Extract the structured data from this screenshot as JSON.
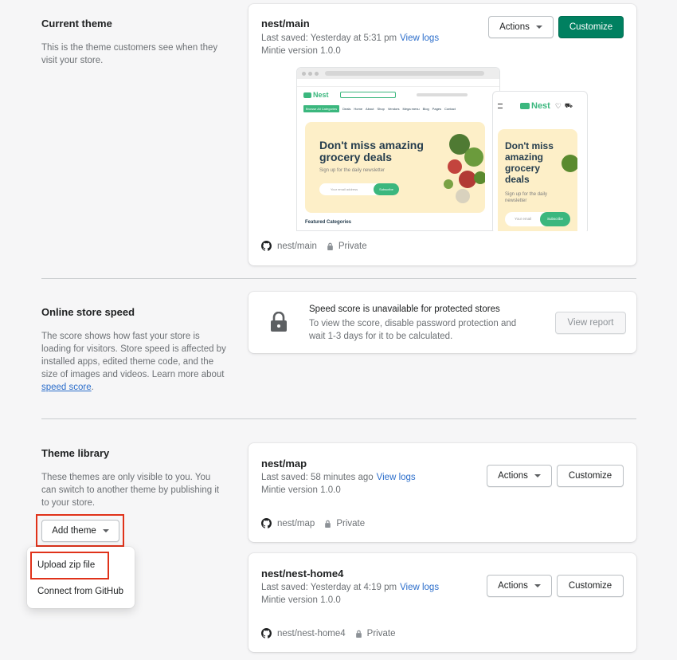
{
  "current_theme": {
    "title": "Current theme",
    "description": "This is the theme customers see when they visit your store.",
    "card": {
      "name": "nest/main",
      "last_saved": "Last saved: Yesterday at 5:31 pm",
      "view_logs": "View logs",
      "version": "Mintie version 1.0.0",
      "actions_label": "Actions",
      "customize_label": "Customize",
      "repo": "nest/main",
      "visibility": "Private"
    },
    "preview": {
      "desktop": {
        "logo": "Nest",
        "category_button": "Browse All Categories",
        "nav": [
          "Deals",
          "Home",
          "About",
          "Shop",
          "Vendors",
          "Mega menu",
          "Blog",
          "Pages",
          "Contact"
        ],
        "headline_line1": "Don't miss amazing",
        "headline_line2": "grocery deals",
        "subtext": "Sign up for the daily newsletter",
        "email_placeholder": "Your email address",
        "subscribe": "Subscribe",
        "featured": "Featured Categories"
      },
      "mobile": {
        "logo": "Nest",
        "headline_line1": "Don't miss",
        "headline_line2": "amazing",
        "headline_line3": "grocery",
        "headline_line4": "deals",
        "subtext": "Sign up for the daily newsletter",
        "email_placeholder": "Your email",
        "subscribe": "Subscribe"
      }
    }
  },
  "speed": {
    "title": "Online store speed",
    "description": "The score shows how fast your store is loading for visitors. Store speed is affected by installed apps, edited theme code, and the size of images and videos. Learn more about ",
    "link": "speed score",
    "period": ".",
    "card_title": "Speed score is unavailable for protected stores",
    "card_text": "To view the score, disable password protection and wait 1-3 days for it to be calculated.",
    "view_report": "View report"
  },
  "library": {
    "title": "Theme library",
    "description": "These themes are only visible to you. You can switch to another theme by publishing it to your store.",
    "add_theme": "Add theme",
    "menu": [
      "Upload zip file",
      "Connect from GitHub"
    ],
    "themes": [
      {
        "name": "nest/map",
        "last_saved": "Last saved: 58 minutes ago",
        "view_logs": "View logs",
        "version": "Mintie version 1.0.0",
        "actions_label": "Actions",
        "customize_label": "Customize",
        "repo": "nest/map",
        "visibility": "Private"
      },
      {
        "name": "nest/nest-home4",
        "last_saved": "Last saved: Yesterday at 4:19 pm",
        "view_logs": "View logs",
        "version": "Mintie version 1.0.0",
        "actions_label": "Actions",
        "customize_label": "Customize",
        "repo": "nest/nest-home4",
        "visibility": "Private"
      }
    ]
  },
  "colors": {
    "primary": "#008060",
    "link": "#2c6ecb",
    "highlight": "#e0321a",
    "preview_green": "#3bb77e",
    "preview_banner": "#fdefc8"
  }
}
